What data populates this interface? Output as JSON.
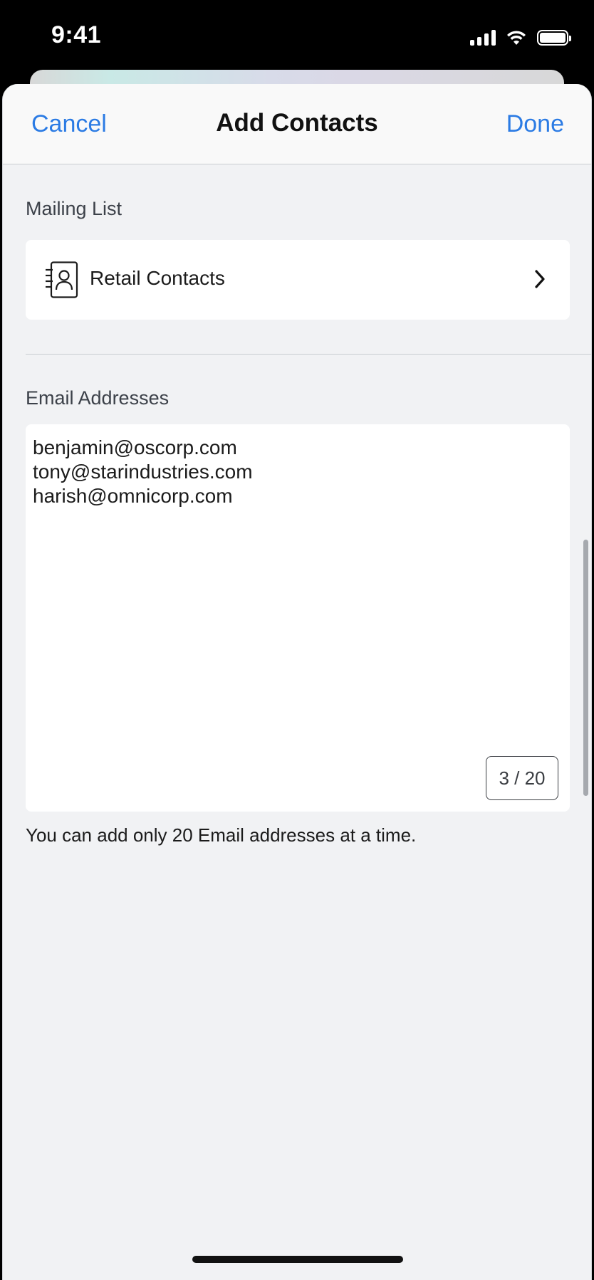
{
  "status_bar": {
    "time": "9:41",
    "icons": [
      "cellular-signal-icon",
      "wifi-icon",
      "battery-icon"
    ]
  },
  "navbar": {
    "cancel_label": "Cancel",
    "title": "Add Contacts",
    "done_label": "Done"
  },
  "mailing_list": {
    "section_label": "Mailing List",
    "selected_name": "Retail Contacts",
    "icon": "contact-book-icon"
  },
  "email_addresses": {
    "section_label": "Email Addresses",
    "value": "benjamin@oscorp.com\ntony@starindustries.com\nharish@omnicorp.com",
    "counter": "3 / 20",
    "helper_text": "You can add only 20 Email addresses at a time."
  },
  "colors": {
    "accent": "#2b7be4",
    "background": "#f1f2f4",
    "card": "#ffffff"
  }
}
